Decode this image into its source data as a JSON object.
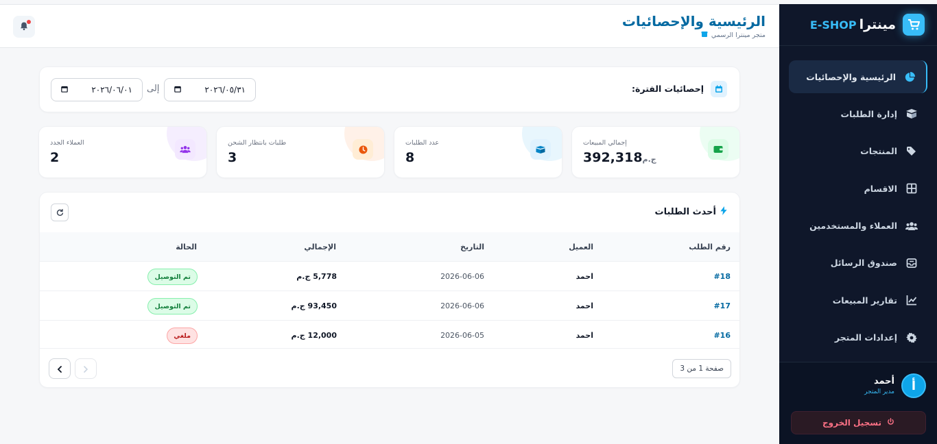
{
  "brand": {
    "name": "مينترا",
    "tag": "E-SHOP",
    "logo_icon": "cart-icon",
    "accent": "#38bdf8"
  },
  "sidebar": {
    "items": [
      {
        "label": "الرئيسية والإحصائيات",
        "icon": "chart-pie-icon",
        "active": true
      },
      {
        "label": "إدارة الطلبات",
        "icon": "box-open-icon"
      },
      {
        "label": "المنتجات",
        "icon": "tags-icon"
      },
      {
        "label": "الاقسام",
        "icon": "grid-icon"
      },
      {
        "label": "العملاء والمستخدمين",
        "icon": "users-icon"
      },
      {
        "label": "صندوق الرسائل",
        "icon": "inbox-icon"
      },
      {
        "label": "تقارير المبيعات",
        "icon": "chart-line-icon"
      },
      {
        "label": "إعدادات المتجر",
        "icon": "gear-icon"
      }
    ],
    "user": {
      "initial": "أ",
      "name": "أحمد",
      "role": "مدير المتجر"
    },
    "logout_label": "تسجيل الخروج"
  },
  "header": {
    "title": "الرئيسية والإحصائيات",
    "subtitle": "متجر مينترا الرسمي",
    "notification_icon": "bell-icon"
  },
  "filter": {
    "label": "إحصائيات الفترة:",
    "from": "٢٠٢٦/٠٥/٣١",
    "to_label": "إلى",
    "to": "٢٠٢٦/٠٦/٠١"
  },
  "stats": [
    {
      "label": "إجمالي المبيعات",
      "value": "392,318",
      "unit": "ج.م",
      "icon": "wallet-icon",
      "color": "#16a34a"
    },
    {
      "label": "عدد الطلبات",
      "value": "8",
      "icon": "box-icon",
      "color": "#0284c7"
    },
    {
      "label": "طلبات بانتظار الشحن",
      "value": "3",
      "icon": "clock-icon",
      "color": "#ea580c"
    },
    {
      "label": "العملاء الجدد",
      "value": "2",
      "icon": "users-icon",
      "color": "#9333ea"
    }
  ],
  "orders": {
    "title": "أحدث الطلبات",
    "columns": {
      "id": "رقم الطلب",
      "customer": "العميل",
      "date": "التاريخ",
      "total": "الإجمالي",
      "status": "الحالة"
    },
    "rows": [
      {
        "id": "#18",
        "customer": "احمد",
        "date": "2026-06-06",
        "total": "5,778 ج.م",
        "status": "تم التوصيل",
        "status_type": "ok"
      },
      {
        "id": "#17",
        "customer": "احمد",
        "date": "2026-06-06",
        "total": "93,450 ج.م",
        "status": "تم التوصيل",
        "status_type": "ok"
      },
      {
        "id": "#16",
        "customer": "احمد",
        "date": "2026-06-05",
        "total": "12,000 ج.م",
        "status": "ملغي",
        "status_type": "cancel"
      }
    ],
    "page_info": "صفحة 1 من 3"
  }
}
